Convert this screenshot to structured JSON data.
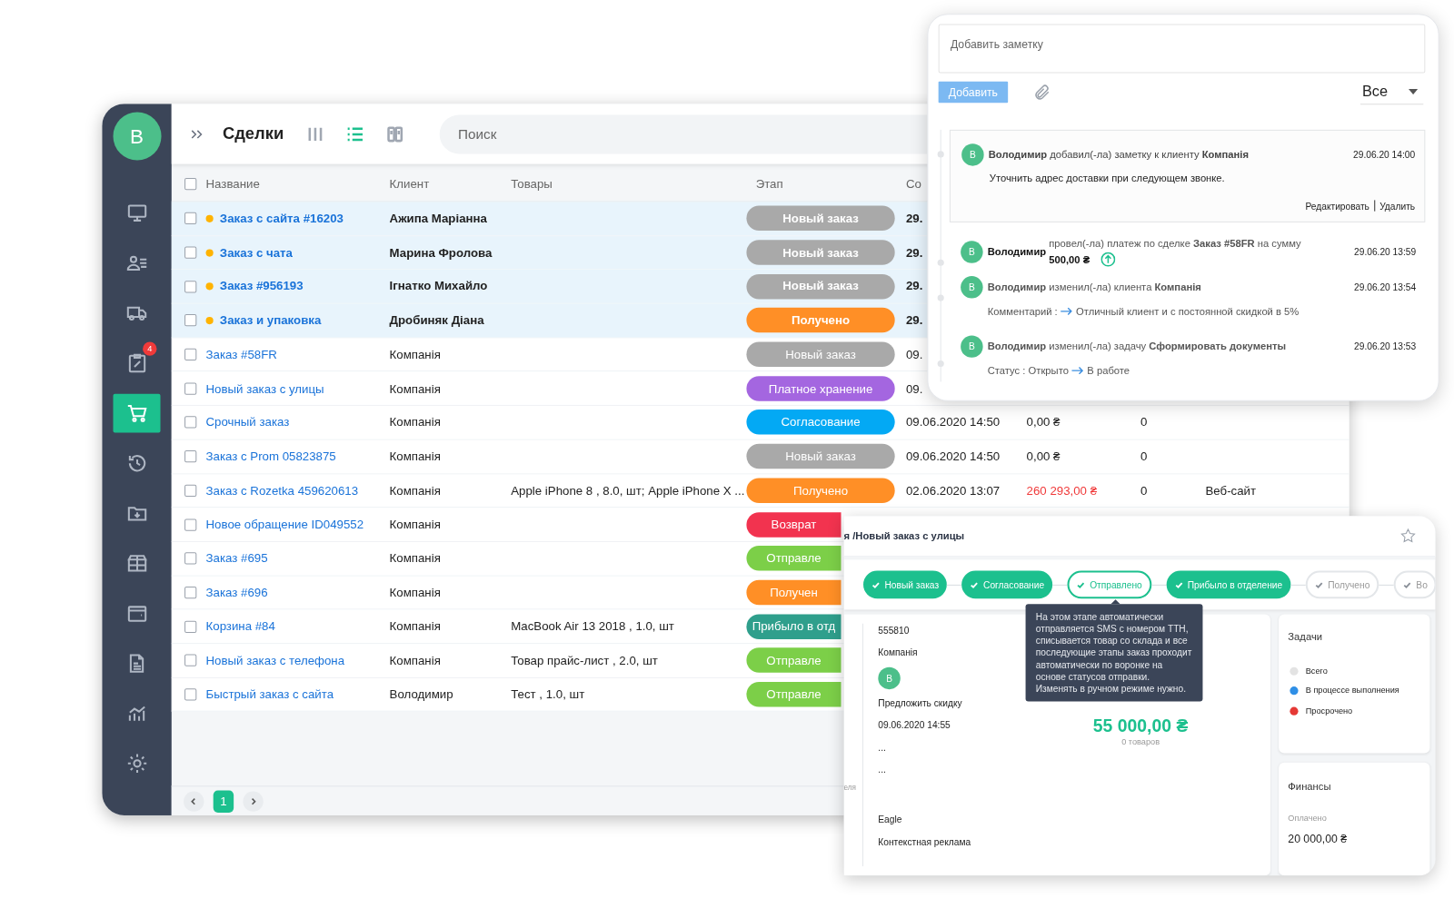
{
  "sidebar": {
    "avatar": "В",
    "items": [
      {
        "selected": false
      },
      {
        "selected": false
      },
      {
        "selected": false
      },
      {
        "selected": false,
        "badge": "4"
      },
      {
        "selected": true
      },
      {
        "selected": false
      },
      {
        "selected": false
      },
      {
        "selected": false
      },
      {
        "selected": false
      },
      {
        "selected": false
      },
      {
        "selected": false
      },
      {
        "selected": false
      }
    ]
  },
  "header": {
    "title": "Сделки",
    "views": [
      {
        "selected": false
      },
      {
        "selected": true
      },
      {
        "selected": false
      }
    ],
    "search": {
      "placeholder": "Поиск"
    }
  },
  "table": {
    "header_checked": false,
    "columns": [
      "Название",
      "Клиент",
      "Товары",
      "Этап",
      "Со"
    ],
    "rows": [
      {
        "checked": false,
        "unread": true,
        "name": "Заказ с сайта #16203",
        "client": "Ажипа Маріанна",
        "stage": {
          "label": "Новый заказ",
          "color": "#a9a9a9",
          "partly_covered": false
        },
        "date": "29."
      },
      {
        "checked": false,
        "unread": true,
        "name": "Заказ с чата",
        "client": "Марина Фролова",
        "stage": {
          "label": "Новый заказ",
          "color": "#a9a9a9",
          "partly_covered": false
        },
        "date": "29."
      },
      {
        "checked": false,
        "unread": true,
        "name": "Заказ #956193",
        "client": "Ігнатко Михайло",
        "stage": {
          "label": "Новый заказ",
          "color": "#a9a9a9",
          "partly_covered": false
        },
        "date": "29."
      },
      {
        "checked": false,
        "unread": true,
        "name": "Заказ и упаковка",
        "client": "Дробиняк Діана",
        "stage": {
          "label": "Получено",
          "color": "#ff8f26",
          "partly_covered": false
        },
        "date": "29."
      },
      {
        "checked": false,
        "unread": false,
        "name": "Заказ #58FR",
        "client": "Компанія",
        "stage": {
          "label": "Новый заказ",
          "color": "#a9a9a9",
          "partly_covered": false
        },
        "date": "09."
      },
      {
        "checked": false,
        "unread": false,
        "name": "Новый заказ с улицы",
        "client": "Компанія",
        "stage": {
          "label": "Платное хранение",
          "color": "#a466e0",
          "partly_covered": false
        },
        "date": "09."
      },
      {
        "checked": false,
        "unread": false,
        "name": "Срочный заказ",
        "client": "Компанія",
        "stage": {
          "label": "Согласование",
          "color": "#03a9f4",
          "partly_covered": false
        },
        "date": "09.06.2020 14:50",
        "sum": "0,00 ₴",
        "sum_alert": false,
        "count": "0"
      },
      {
        "checked": false,
        "unread": false,
        "name": "Заказ с Prom 05823875",
        "client": "Компанія",
        "stage": {
          "label": "Новый заказ",
          "color": "#a9a9a9",
          "partly_covered": false
        },
        "date": "09.06.2020 14:50",
        "sum": "0,00 ₴",
        "sum_alert": false,
        "count": "0"
      },
      {
        "checked": false,
        "unread": false,
        "name": "Заказ с Rozetka 459620613",
        "client": "Компанія",
        "goods": "Apple iPhone 8 , 8.0, шт; Apple iPhone X ...",
        "stage": {
          "label": "Получено",
          "color": "#ff8f26",
          "partly_covered": false
        },
        "date": "02.06.2020 13:07",
        "sum": "260 293,00 ₴",
        "sum_alert": true,
        "count": "0",
        "source": "Веб-сайт"
      },
      {
        "checked": false,
        "unread": false,
        "name": "Новое обращение ID049552",
        "client": "Компанія",
        "stage": {
          "label": "Возврат",
          "color": "#f2334f",
          "partly_covered": true
        }
      },
      {
        "checked": false,
        "unread": false,
        "name": "Заказ #695",
        "client": "Компанія",
        "stage": {
          "label": "Отправле",
          "color": "#7ccf48",
          "partly_covered": true
        }
      },
      {
        "checked": false,
        "unread": false,
        "name": "Заказ #696",
        "client": "Компанія",
        "stage": {
          "label": "Получен",
          "color": "#ff8f26",
          "partly_covered": true
        }
      },
      {
        "checked": false,
        "unread": false,
        "name": "Корзина #84",
        "client": "Компанія",
        "goods": "MacBook Air 13 2018 , 1.0, шт",
        "stage": {
          "label": "Прибыло в отд",
          "color": "#2f9f8c",
          "partly_covered": true
        }
      },
      {
        "checked": false,
        "unread": false,
        "name": "Новый заказ с телефона",
        "client": "Компанія",
        "goods": "Товар прайс-лист , 2.0, шт",
        "stage": {
          "label": "Отправле",
          "color": "#7ccf48",
          "partly_covered": true
        }
      },
      {
        "checked": false,
        "unread": false,
        "name": "Быстрый заказ с сайта",
        "client": "Володимир",
        "goods": "Тест , 1.0, шт",
        "stage": {
          "label": "Отправле",
          "color": "#7ccf48",
          "partly_covered": true
        }
      }
    ]
  },
  "pagination": {
    "pages": [
      {
        "label": "1",
        "selected": true
      }
    ]
  },
  "notes": {
    "input": {
      "placeholder": "Добавить заметку"
    },
    "add_button": "Добавить",
    "filter": "Все",
    "entries": [
      {
        "kind": "note",
        "avatar": "В",
        "text": "**Володимир** добавил(-ла) заметку к клиенту **Компанія**",
        "time": "29.06.20 14:00",
        "body": "Уточнить адрес доставки при следующем звонке.",
        "actions": [
          "Редактировать",
          "Удалить"
        ]
      },
      {
        "kind": "payment",
        "avatar": "В",
        "actor": "Володимир",
        "text": "провел(-ла) платеж по сделке **Заказ #58FR** на сумму",
        "amount": "500,00 ₴",
        "time": "29.06.20 13:59"
      },
      {
        "kind": "change",
        "avatar": "В",
        "text": "**Володимир** изменил(-ла) клиента **Компанія**",
        "time": "29.06.20 13:54",
        "from": "Комментарий :",
        "to": "Отличный клиент и с постоянной скидкой в 5%"
      },
      {
        "kind": "change",
        "avatar": "В",
        "text": "**Володимир** изменил(-ла) задачу **Сформировать документы**",
        "time": "29.06.20 13:53",
        "from": "Статус : Открыто",
        "to": "В работе"
      }
    ]
  },
  "deal": {
    "title": "я /Новый заказ с улицы",
    "starred": false,
    "stages": [
      {
        "label": "Новый заказ",
        "kind": "done"
      },
      {
        "label": "Согласование",
        "kind": "done"
      },
      {
        "label": "Отправлено",
        "kind": "current"
      },
      {
        "label": "Прибыло в отделение",
        "kind": "done"
      },
      {
        "label": "Получено",
        "kind": "pending"
      },
      {
        "label": "Во",
        "kind": "pending"
      }
    ],
    "tooltip": "На этом этапе автоматически отправляется SMS с номером ТТН, списывается товар со склада и все последующие этапы заказ проходит автоматически по воронке на основе статусов отправки. Изменять в ручном режиме нужно.",
    "side_label": "еля",
    "fields": [
      {
        "kind": "text",
        "value": "555810"
      },
      {
        "kind": "text",
        "value": "Компанія"
      },
      {
        "kind": "avatar",
        "value": "В"
      },
      {
        "kind": "text",
        "value": "Предложить скидку"
      },
      {
        "kind": "text",
        "value": "09.06.2020 14:55"
      },
      {
        "kind": "text",
        "value": "..."
      },
      {
        "kind": "text",
        "value": "..."
      },
      {
        "kind": "text",
        "value": "Eagle"
      },
      {
        "kind": "text",
        "value": "Контекстная реклама"
      }
    ],
    "amount": "55 000,00 ₴",
    "items_count": "0 товаров",
    "tasks": {
      "title": "Задачи",
      "legend": [
        {
          "label": "Всего",
          "color": "#e3e3e3"
        },
        {
          "label": "В процессе выполнения",
          "color": "#2f8fe6"
        },
        {
          "label": "Просрочено",
          "color": "#e53935"
        }
      ]
    },
    "finance": {
      "title": "Финансы",
      "label": "Оплачено",
      "value": "20 000,00 ₴"
    }
  }
}
